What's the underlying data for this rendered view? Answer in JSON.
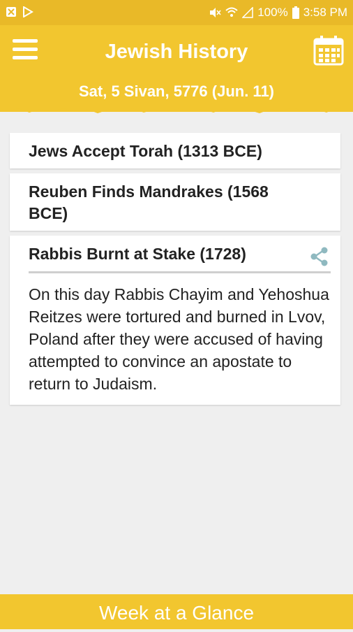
{
  "status_bar": {
    "battery": "100%",
    "time": "3:58 PM",
    "left_icons": [
      "notification-icon",
      "play-store-icon"
    ],
    "right_icons": [
      "mute-icon",
      "wifi-icon",
      "signal-icon",
      "battery-icon"
    ]
  },
  "header": {
    "title": "Jewish History",
    "date": "Sat, 5 Sivan, 5776 (Jun. 11)",
    "menu_icon": "hamburger-menu-icon",
    "calendar_icon": "calendar-icon"
  },
  "events": [
    {
      "title": "Jews Accept Torah (1313 BCE)"
    },
    {
      "title": "Reuben Finds Mandrakes (1568 BCE)"
    },
    {
      "title": "Rabbis Burnt at Stake (1728)",
      "body": "On this day Rabbis Chayim and Yehoshua Reitzes were tortured and burned in Lvov, Poland after they were accused of having attempted to convince an apostate to return to Judaism.",
      "expanded": true
    }
  ],
  "bottom_bar": {
    "label": "Week at a Glance"
  },
  "colors": {
    "accent": "#f2c62f",
    "status_bar": "#e9b928",
    "share_icon": "#8fb9c0"
  }
}
